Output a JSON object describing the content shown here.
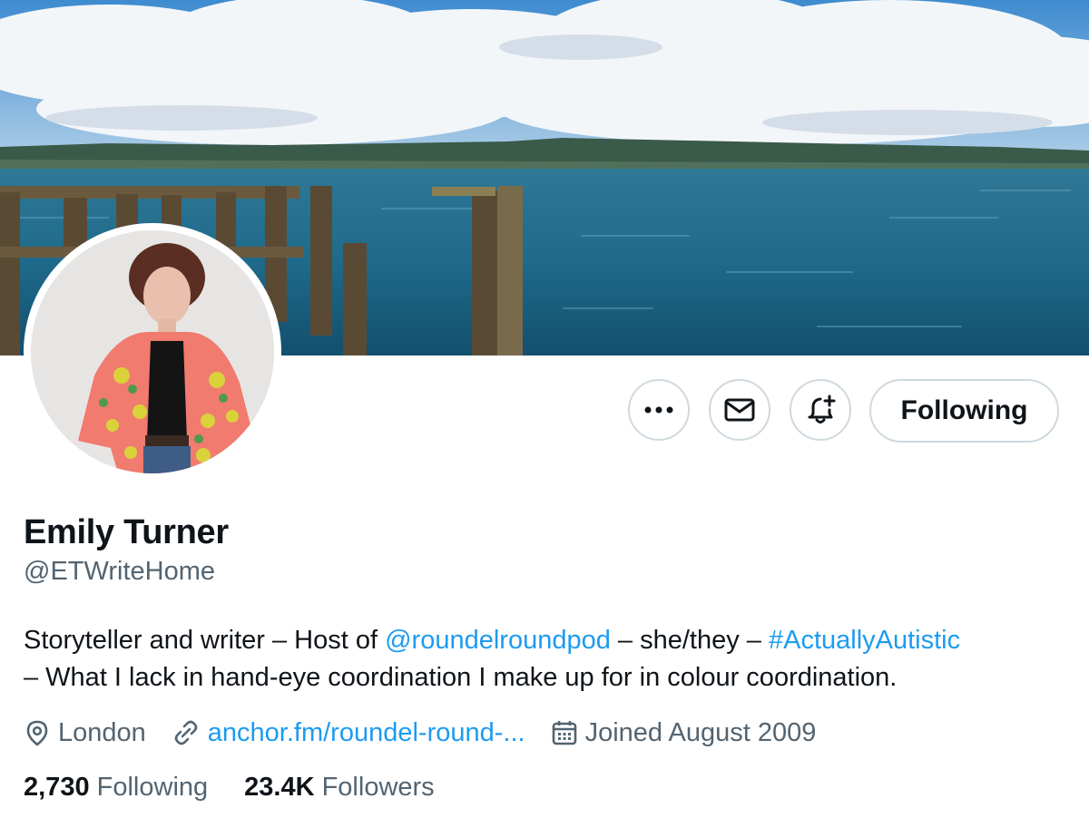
{
  "profile": {
    "name": "Emily Turner",
    "handle": "@ETWriteHome",
    "bio": {
      "part1": "Storyteller and writer – Host of ",
      "mention": "@roundelroundpod",
      "part2": " – she/they – ",
      "hashtag": "#ActuallyAutistic",
      "part3": "– What I lack in hand-eye coordination I make up for in colour coordination."
    },
    "location": "London",
    "website": "anchor.fm/roundel-round-...",
    "joined": "Joined August 2009"
  },
  "stats": {
    "following_count": "2,730",
    "following_label": "Following",
    "followers_count": "23.4K",
    "followers_label": "Followers"
  },
  "actions": {
    "more_icon": "more-icon",
    "message_icon": "mail-icon",
    "notify_icon": "bell-plus-icon",
    "follow_label": "Following"
  },
  "colors": {
    "link": "#1d9bf0",
    "secondary_text": "#536471",
    "border": "#cfd9de"
  }
}
